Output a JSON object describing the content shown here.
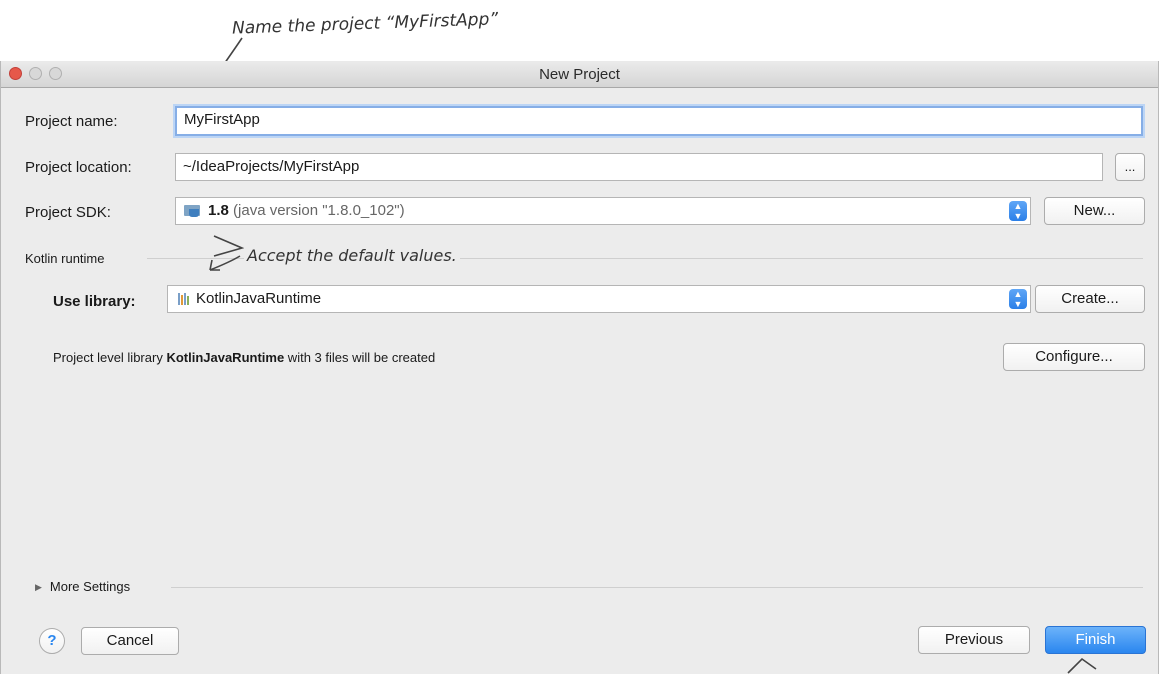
{
  "annotations": {
    "top": "Name the project “MyFirstApp”",
    "middle": "Accept the default values."
  },
  "window": {
    "title": "New Project"
  },
  "form": {
    "project_name_label": "Project name:",
    "project_name_value": "MyFirstApp",
    "project_location_label": "Project location:",
    "project_location_value": "~/IdeaProjects/MyFirstApp",
    "browse_label": "...",
    "project_sdk_label": "Project SDK:",
    "sdk_version": "1.8",
    "sdk_detail": "(java version \"1.8.0_102\")",
    "sdk_new_label": "New...",
    "kotlin_runtime_label": "Kotlin runtime",
    "use_library_label": "Use library:",
    "library_value": "KotlinJavaRuntime",
    "create_label": "Create...",
    "info_prefix": "Project level library ",
    "info_library": "KotlinJavaRuntime",
    "info_suffix": " with 3 files will be created",
    "configure_label": "Configure...",
    "more_settings_label": "More Settings"
  },
  "footer": {
    "help_label": "?",
    "cancel_label": "Cancel",
    "previous_label": "Previous",
    "finish_label": "Finish"
  },
  "colors": {
    "accent": "#2a86ef",
    "focus_ring": "#86aee6",
    "window_bg": "#ececec"
  },
  "icons": {
    "close": "close-icon",
    "minimize": "minimize-icon",
    "zoom": "zoom-icon",
    "sdk": "sdk-folder-icon",
    "library": "library-icon",
    "stepper": "chevron-updown-icon",
    "disclosure": "disclosure-triangle-icon"
  }
}
